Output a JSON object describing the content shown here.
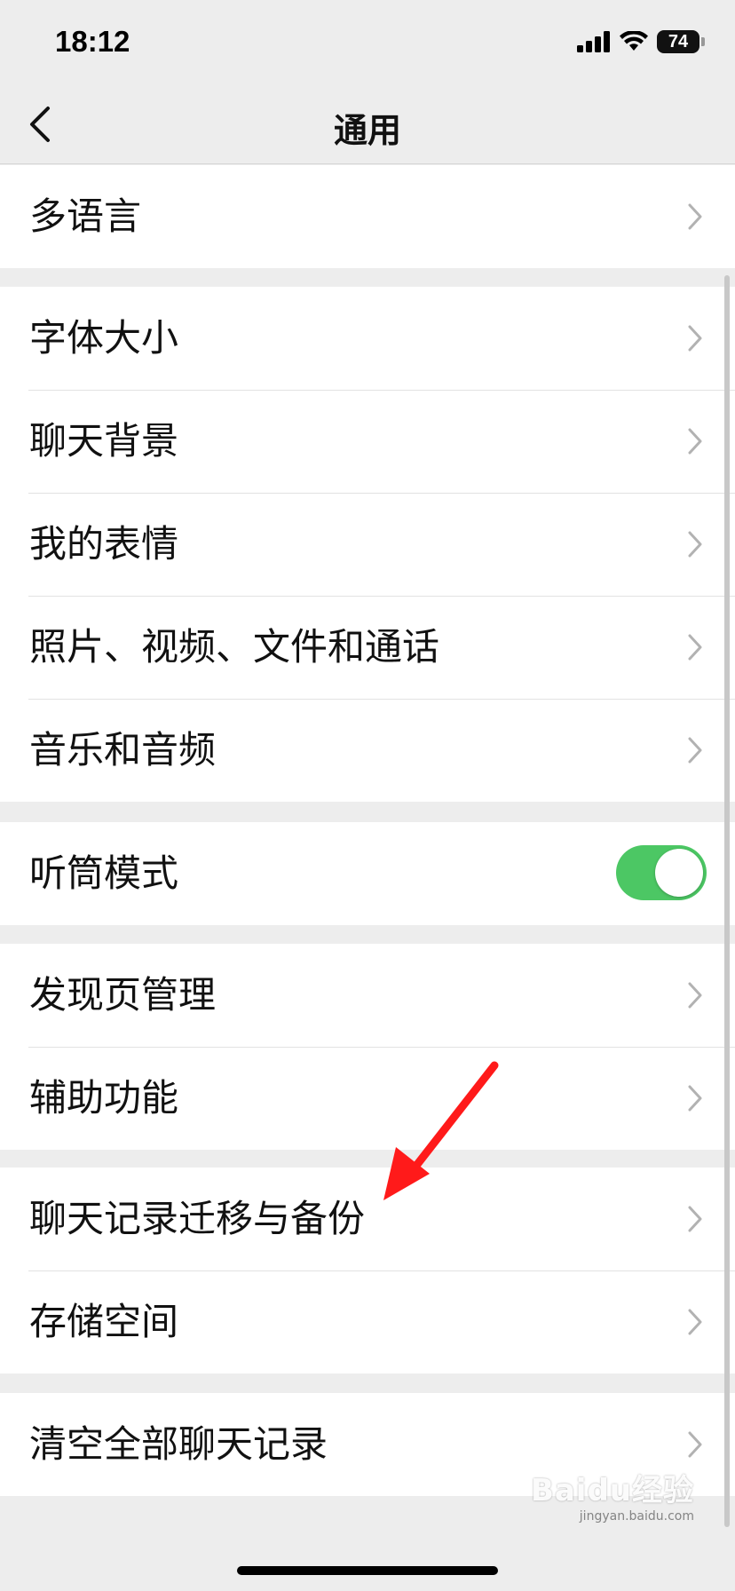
{
  "status_bar": {
    "time": "18:12",
    "battery": "74"
  },
  "nav": {
    "title": "通用"
  },
  "groups": [
    {
      "items": [
        {
          "label": "多语言"
        }
      ]
    },
    {
      "items": [
        {
          "label": "字体大小"
        },
        {
          "label": "聊天背景"
        },
        {
          "label": "我的表情"
        },
        {
          "label": "照片、视频、文件和通话"
        },
        {
          "label": "音乐和音频"
        }
      ]
    },
    {
      "items": [
        {
          "label": "听筒模式",
          "toggle_on": true
        }
      ]
    },
    {
      "items": [
        {
          "label": "发现页管理"
        },
        {
          "label": "辅助功能"
        }
      ]
    },
    {
      "items": [
        {
          "label": "聊天记录迁移与备份"
        },
        {
          "label": "存储空间"
        }
      ]
    },
    {
      "items": [
        {
          "label": "清空全部聊天记录"
        }
      ]
    }
  ],
  "watermark": {
    "main": "Baidu经验",
    "sub": "jingyan.baidu.com"
  },
  "colors": {
    "toggle_on": "#4cc764",
    "annotation_arrow": "#ff1a1a",
    "background": "#ededed",
    "cell": "#ffffff"
  },
  "icons": {
    "back": "chevron-left-icon",
    "row_arrow": "chevron-right-icon",
    "signal": "cellular-signal-icon",
    "wifi": "wifi-icon",
    "battery": "battery-icon"
  }
}
